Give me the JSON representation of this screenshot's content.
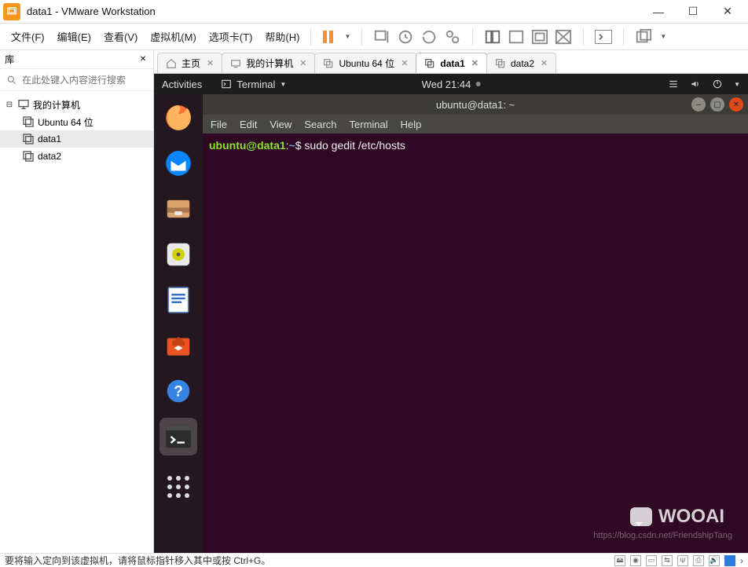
{
  "window": {
    "title": "data1 - VMware Workstation"
  },
  "menu": {
    "file": "文件(F)",
    "edit": "编辑(E)",
    "view": "查看(V)",
    "vm": "虚拟机(M)",
    "tabs": "选项卡(T)",
    "help": "帮助(H)"
  },
  "sidebar": {
    "title": "库",
    "search_placeholder": "在此处键入内容进行搜索",
    "root": {
      "label": "我的计算机"
    },
    "items": [
      {
        "label": "Ubuntu 64 位",
        "selected": false
      },
      {
        "label": "data1",
        "selected": true
      },
      {
        "label": "data2",
        "selected": false
      }
    ]
  },
  "tabs": [
    {
      "label": "主页",
      "kind": "home",
      "active": false
    },
    {
      "label": "我的计算机",
      "kind": "computer",
      "active": false
    },
    {
      "label": "Ubuntu 64 位",
      "kind": "vm",
      "active": false
    },
    {
      "label": "data1",
      "kind": "vm",
      "active": true
    },
    {
      "label": "data2",
      "kind": "vm",
      "active": false
    }
  ],
  "ubuntu": {
    "topbar": {
      "activities": "Activities",
      "app": "Terminal",
      "time": "Wed 21:44"
    },
    "window_title": "ubuntu@data1: ~",
    "menubar": [
      "File",
      "Edit",
      "View",
      "Search",
      "Terminal",
      "Help"
    ],
    "prompt": {
      "userhost": "ubuntu@data1",
      "path": "~",
      "command": "sudo gedit /etc/hosts"
    }
  },
  "footer": {
    "text": "要将输入定向到该虚拟机，请将鼠标指针移入其中或按 Ctrl+G。"
  },
  "watermark": {
    "big": "WOOAI",
    "url": "https://blog.csdn.net/FriendshipTang"
  }
}
